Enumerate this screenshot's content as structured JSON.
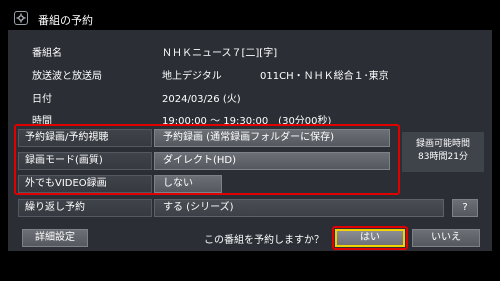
{
  "title": "番組の予約",
  "program": {
    "name_label": "番組名",
    "name_value": "ＮＨＫニュース７[二][字]",
    "broadcast_label": "放送波と放送局",
    "broadcast_type": "地上デジタル",
    "broadcast_station": "011CH・ＮＨＫ総合１･東京",
    "date_label": "日付",
    "date_value": "2024/03/26 (火)",
    "time_label": "時間",
    "time_value": "19:00:00 ～ 19:30:00　(30分00秒)"
  },
  "settings": {
    "reserve_label": "予約録画/予約視聴",
    "reserve_value": "予約録画 (通常録画フォルダーに保存)",
    "mode_label": "録画モード(画質)",
    "mode_value": "ダイレクト(HD)",
    "outside_label": "外でもVIDEO録画",
    "outside_value": "しない",
    "repeat_label": "繰り返し予約",
    "repeat_value": "する (シリーズ)",
    "help_label": "?"
  },
  "capacity": {
    "label": "録画可能時間",
    "value": "83時間21分"
  },
  "footer": {
    "advanced_label": "詳細設定",
    "question": "この番組を予約しますか？",
    "yes_label": "はい",
    "no_label": "いいえ"
  },
  "colors": {
    "highlight_red": "#e00000",
    "focus_yellow": "#f2d200",
    "panel_bg": "#2b2f35"
  },
  "icons": {
    "title_icon": "gear-icon"
  }
}
